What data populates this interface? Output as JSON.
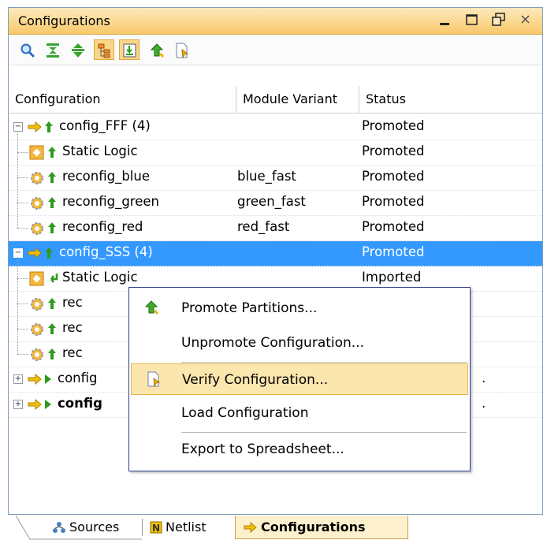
{
  "panel": {
    "title": "Configurations"
  },
  "window_controls": [
    "minimize-icon",
    "maximize-icon",
    "float-icon",
    "close-icon"
  ],
  "toolbar": {
    "buttons": [
      "search-icon",
      "collapse-all-icon",
      "expand-all-icon",
      "hierarchy-icon",
      "show-all-icon",
      "promote-icon",
      "verify-icon"
    ],
    "active": [
      "hierarchy-icon",
      "show-all-icon"
    ]
  },
  "table": {
    "headers": [
      "Configuration",
      "Module Variant",
      "Status"
    ],
    "rows": [
      {
        "name": "config_FFF (4)",
        "module": "",
        "status": "Promoted"
      },
      {
        "name": "Static Logic",
        "module": "",
        "status": "Promoted"
      },
      {
        "name": "reconfig_blue",
        "module": "blue_fast",
        "status": "Promoted"
      },
      {
        "name": "reconfig_green",
        "module": "green_fast",
        "status": "Promoted"
      },
      {
        "name": "reconfig_red",
        "module": "red_fast",
        "status": "Promoted"
      },
      {
        "name": "config_SSS (4)",
        "module": "",
        "status": "Promoted"
      },
      {
        "name": "Static Logic",
        "module": "",
        "status": "Imported"
      },
      {
        "name": "rec",
        "module": "",
        "status": ""
      },
      {
        "name": "rec",
        "module": "",
        "status": ""
      },
      {
        "name": "rec",
        "module": "",
        "status": ""
      },
      {
        "name": "config",
        "module": "",
        "status": "."
      },
      {
        "name": "config",
        "module": "",
        "status": "."
      }
    ]
  },
  "context_menu": {
    "items": [
      {
        "label": "Promote Partitions..."
      },
      {
        "label": "Unpromote Configuration..."
      },
      {
        "label": "Verify Configuration..."
      },
      {
        "label": "Load Configuration"
      },
      {
        "label": "Export to Spreadsheet..."
      }
    ]
  },
  "bottom_tabs": {
    "sources": "Sources",
    "netlist": "Netlist",
    "configurations": "Configurations"
  },
  "colors": {
    "title_bar": "#f8c96a",
    "selection": "#3399ff",
    "menu_highlight": "#fbe6ad",
    "promote_arrow": "#2e9a1e"
  }
}
